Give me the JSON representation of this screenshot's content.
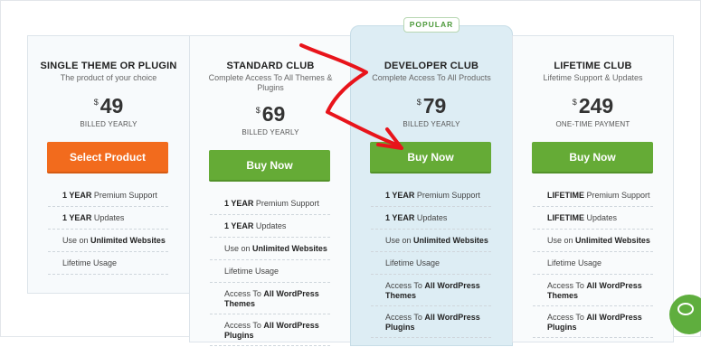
{
  "popular_badge": "POPULAR",
  "plans": [
    {
      "title": "SINGLE THEME OR PLUGIN",
      "subtitle": "The product of your choice",
      "currency": "$",
      "price": "49",
      "billing": "BILLED YEARLY",
      "button": "Select Product",
      "features": [
        {
          "bold": "1 YEAR",
          "text": " Premium Support"
        },
        {
          "bold": "1 YEAR",
          "text": " Updates"
        },
        {
          "pre": "Use on ",
          "bold": "Unlimited Websites"
        },
        {
          "text": "Lifetime Usage"
        }
      ]
    },
    {
      "title": "STANDARD CLUB",
      "subtitle": "Complete Access To All Themes & Plugins",
      "currency": "$",
      "price": "69",
      "billing": "BILLED YEARLY",
      "button": "Buy Now",
      "features": [
        {
          "bold": "1 YEAR",
          "text": " Premium Support"
        },
        {
          "bold": "1 YEAR",
          "text": " Updates"
        },
        {
          "pre": "Use on ",
          "bold": "Unlimited Websites"
        },
        {
          "text": "Lifetime Usage"
        },
        {
          "pre": "Access To ",
          "bold": "All WordPress Themes"
        },
        {
          "pre": "Access To ",
          "bold": "All WordPress Plugins"
        }
      ]
    },
    {
      "title": "DEVELOPER CLUB",
      "subtitle": "Complete Access To All Products",
      "currency": "$",
      "price": "79",
      "billing": "BILLED YEARLY",
      "button": "Buy Now",
      "features": [
        {
          "bold": "1 YEAR",
          "text": " Premium Support"
        },
        {
          "bold": "1 YEAR",
          "text": " Updates"
        },
        {
          "pre": "Use on ",
          "bold": "Unlimited Websites"
        },
        {
          "text": "Lifetime Usage"
        },
        {
          "pre": "Access To ",
          "bold": "All WordPress Themes"
        },
        {
          "pre": "Access To ",
          "bold": "All WordPress Plugins"
        }
      ]
    },
    {
      "title": "LIFETIME CLUB",
      "subtitle": "Lifetime Support & Updates",
      "currency": "$",
      "price": "249",
      "billing": "ONE-TIME PAYMENT",
      "button": "Buy Now",
      "features": [
        {
          "bold": "LIFETIME",
          "text": " Premium Support"
        },
        {
          "bold": "LIFETIME",
          "text": " Updates"
        },
        {
          "pre": "Use on ",
          "bold": "Unlimited Websites"
        },
        {
          "text": "Lifetime Usage"
        },
        {
          "pre": "Access To ",
          "bold": "All WordPress Themes"
        },
        {
          "pre": "Access To ",
          "bold": "All WordPress Plugins"
        }
      ]
    }
  ],
  "colors": {
    "orange_button": "#f26b1d",
    "green_button": "#65ab36",
    "highlight_column": "#ddedf4",
    "annotation_arrow": "#e8141b"
  }
}
